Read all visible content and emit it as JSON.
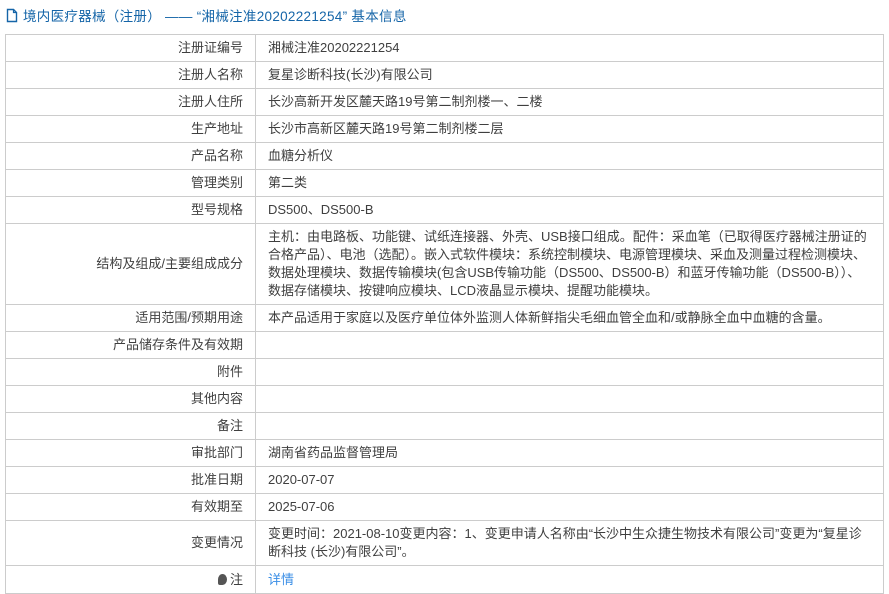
{
  "header": {
    "title": "境内医疗器械（注册） ——  “湘械注准20202221254”  基本信息"
  },
  "table": {
    "rows": [
      {
        "label": "注册证编号",
        "value": "湘械注准20202221254"
      },
      {
        "label": "注册人名称",
        "value": "复星诊断科技(长沙)有限公司"
      },
      {
        "label": "注册人住所",
        "value": "长沙高新开发区麓天路19号第二制剂楼一、二楼"
      },
      {
        "label": "生产地址",
        "value": "长沙市高新区麓天路19号第二制剂楼二层"
      },
      {
        "label": "产品名称",
        "value": "血糖分析仪"
      },
      {
        "label": "管理类别",
        "value": "第二类"
      },
      {
        "label": "型号规格",
        "value": "DS500、DS500-B"
      },
      {
        "label": "结构及组成/主要组成成分",
        "value": "主机：由电路板、功能键、试纸连接器、外壳、USB接口组成。配件：采血笔（已取得医疗器械注册证的合格产品）、电池（选配）。嵌入式软件模块：系统控制模块、电源管理模块、采血及测量过程检测模块、数据处理模块、数据传输模块(包含USB传输功能（DS500、DS500-B）和蓝牙传输功能（DS500-B））、数据存储模块、按键响应模块、LCD液晶显示模块、提醒功能模块。"
      },
      {
        "label": "适用范围/预期用途",
        "value": "本产品适用于家庭以及医疗单位体外监测人体新鲜指尖毛细血管全血和/或静脉全血中血糖的含量。"
      },
      {
        "label": "产品储存条件及有效期",
        "value": ""
      },
      {
        "label": "附件",
        "value": ""
      },
      {
        "label": "其他内容",
        "value": ""
      },
      {
        "label": "备注",
        "value": ""
      },
      {
        "label": "审批部门",
        "value": "湖南省药品监督管理局"
      },
      {
        "label": "批准日期",
        "value": "2020-07-07"
      },
      {
        "label": "有效期至",
        "value": "2025-07-06"
      },
      {
        "label": "变更情况",
        "value": "变更时间：2021-08-10变更内容：1、变更申请人名称由“长沙中生众捷生物技术有限公司”变更为“复星诊断科技 (长沙)有限公司”。"
      }
    ]
  },
  "note_row": {
    "label": "注",
    "link_label": "详情"
  },
  "colors": {
    "header_blue": "#1565a8",
    "link_blue": "#3a8ee6",
    "border_gray": "#cccccc"
  }
}
